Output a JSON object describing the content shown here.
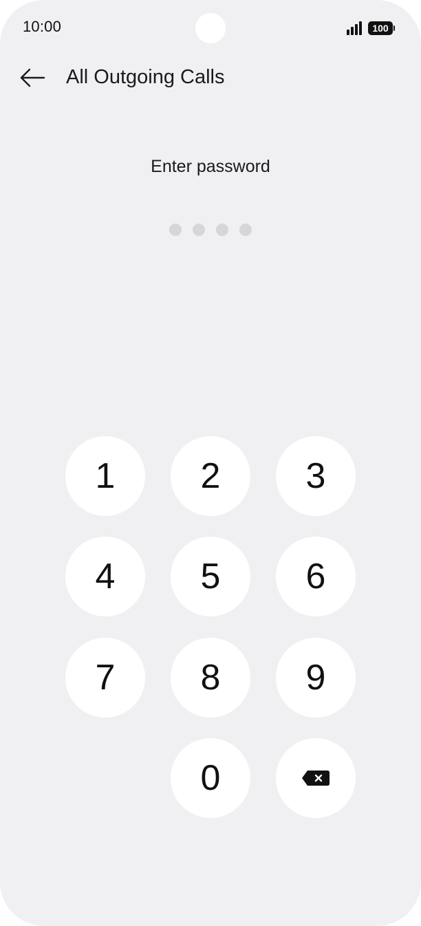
{
  "status_bar": {
    "time": "10:00",
    "battery": "100"
  },
  "header": {
    "back_icon": "arrow-left-icon",
    "title": "All Outgoing Calls"
  },
  "password": {
    "prompt": "Enter password",
    "length": 4,
    "entered": 0
  },
  "keypad": {
    "keys": [
      "1",
      "2",
      "3",
      "4",
      "5",
      "6",
      "7",
      "8",
      "9",
      "0"
    ],
    "backspace_icon": "backspace-icon"
  }
}
